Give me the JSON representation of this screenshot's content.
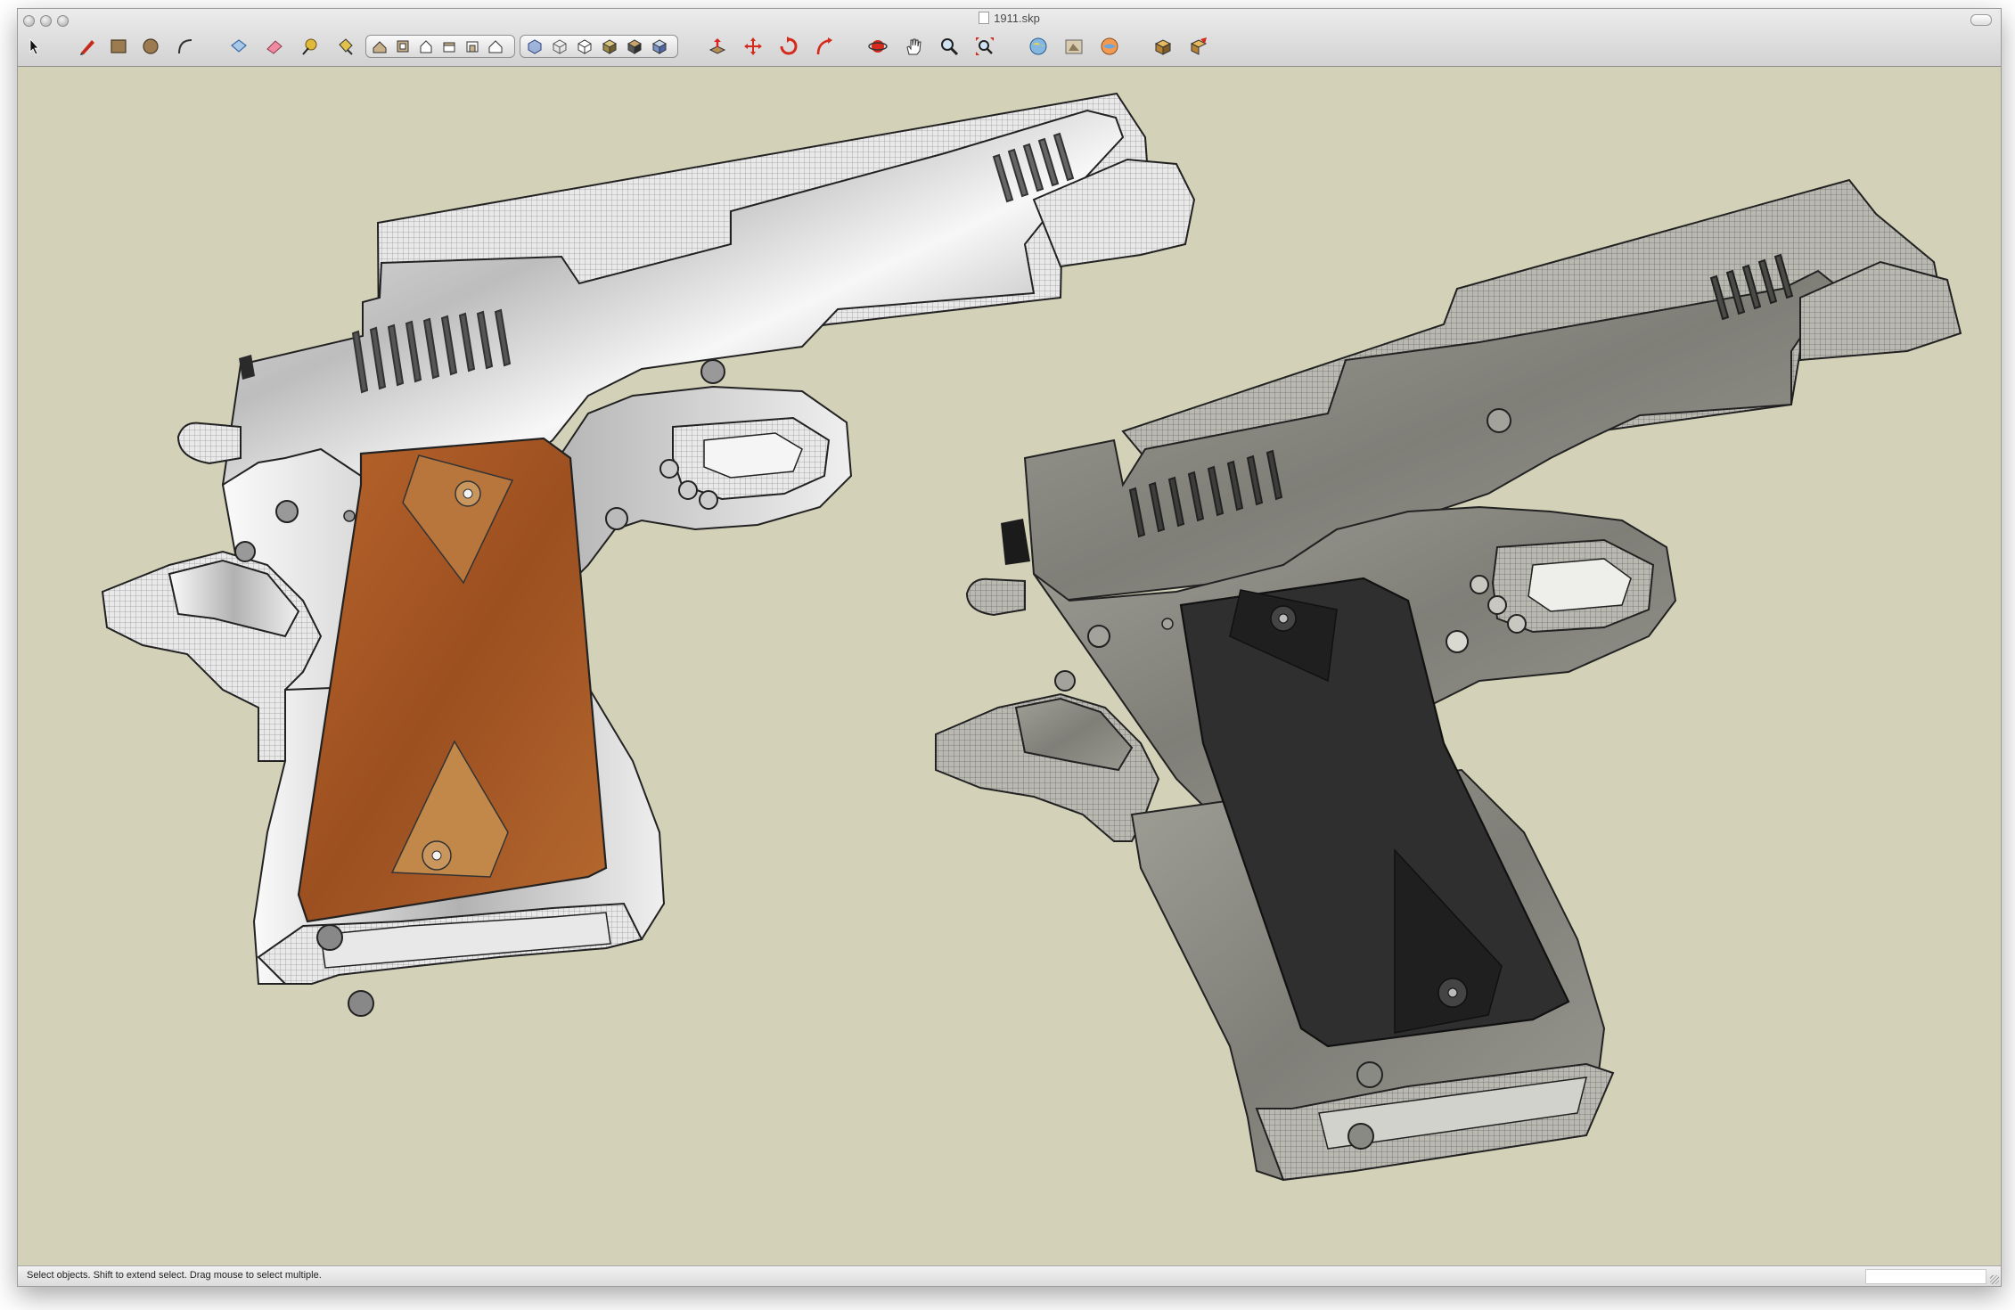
{
  "window": {
    "title": "1911.skp"
  },
  "toolbar": {
    "tools": [
      {
        "name": "select-tool",
        "icon": "arrow-icon"
      },
      {
        "name": "line-tool",
        "icon": "pencil-icon"
      },
      {
        "name": "rectangle-tool",
        "icon": "rectangle-icon"
      },
      {
        "name": "circle-tool",
        "icon": "circle-icon"
      },
      {
        "name": "arc-tool",
        "icon": "arc-icon"
      },
      {
        "name": "make-component-tool",
        "icon": "component-icon"
      },
      {
        "name": "eraser-tool",
        "icon": "eraser-icon"
      },
      {
        "name": "tape-measure-tool",
        "icon": "tape-measure-icon"
      },
      {
        "name": "paint-bucket-tool",
        "icon": "paint-bucket-icon"
      },
      {
        "name": "view-iso",
        "icon": "iso-view-icon"
      },
      {
        "name": "view-top",
        "icon": "top-view-icon"
      },
      {
        "name": "view-front",
        "icon": "front-view-icon"
      },
      {
        "name": "view-right",
        "icon": "right-view-icon"
      },
      {
        "name": "view-back",
        "icon": "back-view-icon"
      },
      {
        "name": "view-left",
        "icon": "left-view-icon"
      },
      {
        "name": "style-xray",
        "icon": "xray-style-icon"
      },
      {
        "name": "style-wireframe",
        "icon": "wireframe-style-icon"
      },
      {
        "name": "style-hidden-line",
        "icon": "hidden-line-style-icon"
      },
      {
        "name": "style-shaded",
        "icon": "shaded-style-icon"
      },
      {
        "name": "style-shaded-textures",
        "icon": "shaded-textures-style-icon"
      },
      {
        "name": "style-monochrome",
        "icon": "monochrome-style-icon"
      },
      {
        "name": "push-pull-tool",
        "icon": "push-pull-icon"
      },
      {
        "name": "move-tool",
        "icon": "move-icon"
      },
      {
        "name": "rotate-tool",
        "icon": "rotate-icon"
      },
      {
        "name": "follow-me-tool",
        "icon": "follow-me-icon"
      },
      {
        "name": "orbit-tool",
        "icon": "orbit-icon"
      },
      {
        "name": "pan-tool",
        "icon": "hand-icon"
      },
      {
        "name": "zoom-tool",
        "icon": "magnifier-icon"
      },
      {
        "name": "zoom-extents-tool",
        "icon": "zoom-extents-icon"
      },
      {
        "name": "get-models-tool",
        "icon": "globe-icon"
      },
      {
        "name": "share-model-tool",
        "icon": "share-model-icon"
      },
      {
        "name": "google-earth-tool",
        "icon": "earth-icon"
      },
      {
        "name": "get-component-tool",
        "icon": "component-box-icon"
      },
      {
        "name": "extension-tool",
        "icon": "extension-icon"
      }
    ]
  },
  "status": {
    "hint": "Select objects. Shift to extend select. Drag mouse to select multiple.",
    "measurements_value": ""
  },
  "scene": {
    "background_color": "#d3d1b8",
    "models": [
      {
        "name": "1911 pistol with wood grips",
        "frame_color": "#d8d8d8",
        "grip_color": "#a9592a"
      },
      {
        "name": "1911 pistol with black grips",
        "frame_color": "#8c8c84",
        "grip_color": "#2f2f2f"
      }
    ]
  }
}
